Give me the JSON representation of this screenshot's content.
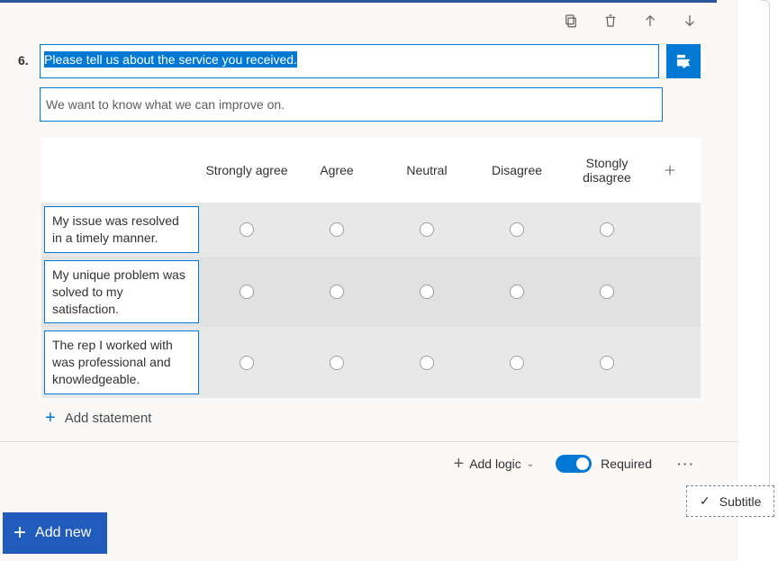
{
  "question": {
    "number": "6.",
    "title": "Please tell us about the service you received.",
    "subtitle": "We want to know what we can improve on."
  },
  "columns": [
    "Strongly agree",
    "Agree",
    "Neutral",
    "Disagree",
    "Stongly disagree"
  ],
  "statements": [
    "My issue was resolved in a timely manner.",
    "My unique problem was solved to my satisfaction.",
    "The rep I worked with was professional and knowledgeable."
  ],
  "actions": {
    "add_statement": "Add statement",
    "add_logic": "Add logic",
    "required": "Required",
    "add_new": "Add new"
  },
  "popup": {
    "subtitle": "Subtitle"
  },
  "icons": {
    "copy": "copy-icon",
    "delete": "trash-icon",
    "move_up": "arrow-up-icon",
    "move_down": "arrow-down-icon",
    "format": "format-icon",
    "add_column": "plus-icon",
    "more": "more-icon",
    "check": "check-icon"
  },
  "toggle": {
    "required_on": true
  },
  "colors": {
    "primary": "#0078d4",
    "accent": "#215bbb"
  }
}
